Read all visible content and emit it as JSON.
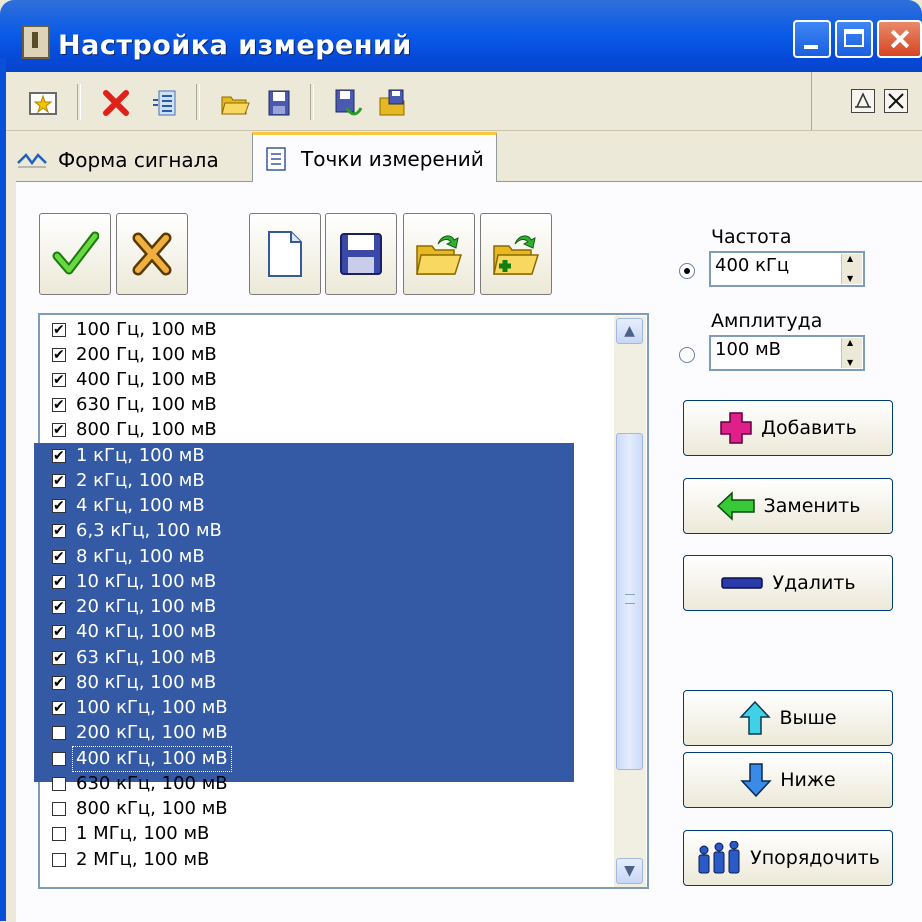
{
  "window": {
    "title": "Настройка измерений"
  },
  "tabs": [
    {
      "label": "Форма сигнала",
      "icon": "waveform-icon"
    },
    {
      "label": "Точки измерений",
      "icon": "list-document-icon",
      "active": true
    }
  ],
  "list": {
    "items": [
      {
        "label": "100 Гц, 100 мВ",
        "checked": true
      },
      {
        "label": "200 Гц, 100 мВ",
        "checked": true
      },
      {
        "label": "400 Гц, 100 мВ",
        "checked": true
      },
      {
        "label": "630 Гц, 100 мВ",
        "checked": true
      },
      {
        "label": "800 Гц, 100 мВ",
        "checked": true
      },
      {
        "label": "1 кГц, 100 мВ",
        "checked": true,
        "selected": true
      },
      {
        "label": "2 кГц, 100 мВ",
        "checked": true,
        "selected": true
      },
      {
        "label": "4 кГц, 100 мВ",
        "checked": true,
        "selected": true
      },
      {
        "label": "6,3 кГц, 100 мВ",
        "checked": true,
        "selected": true
      },
      {
        "label": "8 кГц, 100 мВ",
        "checked": true,
        "selected": true
      },
      {
        "label": "10 кГц, 100 мВ",
        "checked": true,
        "selected": true
      },
      {
        "label": "20 кГц, 100 мВ",
        "checked": true,
        "selected": true
      },
      {
        "label": "40 кГц, 100 мВ",
        "checked": true,
        "selected": true
      },
      {
        "label": "63 кГц, 100 мВ",
        "checked": true,
        "selected": true
      },
      {
        "label": "80 кГц, 100 мВ",
        "checked": true,
        "selected": true
      },
      {
        "label": "100 кГц, 100 мВ",
        "checked": true,
        "selected": true
      },
      {
        "label": "200 кГц, 100 мВ",
        "checked": false,
        "selected": true
      },
      {
        "label": "400 кГц, 100 мВ",
        "checked": false,
        "selected": true,
        "focused": true
      },
      {
        "label": "630 кГц, 100 мВ",
        "checked": false
      },
      {
        "label": "800 кГц, 100 мВ",
        "checked": false
      },
      {
        "label": "1 МГц, 100 мВ",
        "checked": false
      },
      {
        "label": "2 МГц, 100 мВ",
        "checked": false
      }
    ]
  },
  "frequency": {
    "label": "Частота",
    "value": "400 кГц",
    "selected": true
  },
  "amplitude": {
    "label": "Амплитуда",
    "value": "100 мВ",
    "selected": false
  },
  "buttons": {
    "add": "Добавить",
    "replace": "Заменить",
    "delete": "Удалить",
    "up": "Выше",
    "down": "Ниже",
    "sort": "Упорядочить"
  }
}
